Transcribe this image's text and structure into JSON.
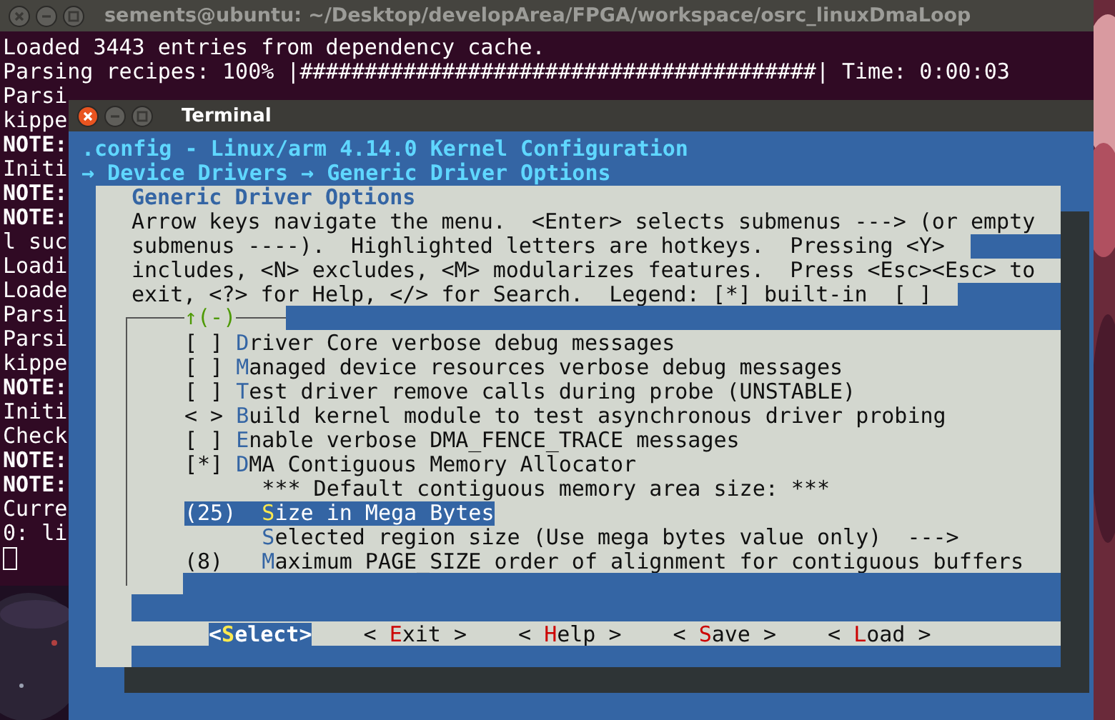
{
  "back_terminal": {
    "title": "sements@ubuntu: ~/Desktop/developArea/FPGA/workspace/osrc_linuxDmaLoop",
    "lines": [
      {
        "text": "Loaded 3443 entries from dependency cache.",
        "bold": false
      },
      {
        "text": "Parsing recipes: 100% |########################################| Time: 0:00:03",
        "bold": false
      },
      {
        "text": "Parsi",
        "bold": false
      },
      {
        "text": "kippe",
        "bold": false
      },
      {
        "text": "NOTE:",
        "bold": true
      },
      {
        "text": "Initi",
        "bold": false
      },
      {
        "text": "NOTE:",
        "bold": true
      },
      {
        "text": "NOTE:",
        "bold": true
      },
      {
        "text": "l suc",
        "bold": false
      },
      {
        "text": "Loadi",
        "bold": false
      },
      {
        "text": "Loade",
        "bold": false
      },
      {
        "text": "Parsi",
        "bold": false
      },
      {
        "text": "Parsi",
        "bold": false
      },
      {
        "text": "kippe",
        "bold": false
      },
      {
        "text": "NOTE:",
        "bold": true
      },
      {
        "text": "Initi",
        "bold": false
      },
      {
        "text": "Check",
        "bold": false
      },
      {
        "text": "NOTE:",
        "bold": true
      },
      {
        "text": "NOTE:",
        "bold": true
      },
      {
        "text": "Curre",
        "bold": false
      },
      {
        "text": "0: li",
        "bold": false
      }
    ]
  },
  "terminal": {
    "title": "Terminal",
    "header": ".config - Linux/arm 4.14.0 Kernel Configuration",
    "breadcrumb": "→ Device Drivers → Generic Driver Options",
    "dialog": {
      "title": "Generic Driver Options",
      "help_lines": [
        "Arrow keys navigate the menu.  <Enter> selects submenus ---> (or empty",
        "submenus ----).  Highlighted letters are hotkeys.  Pressing <Y>",
        "includes, <N> excludes, <M> modularizes features.  Press <Esc><Esc> to",
        "exit, <?> for Help, </> for Search.  Legend: [*] built-in  [ ]"
      ],
      "scroll_indicator": "↑(-)",
      "items": [
        {
          "value": "[ ]",
          "key": "D",
          "rest": "river Core verbose debug messages",
          "indented": false,
          "selected": false
        },
        {
          "value": "[ ]",
          "key": "M",
          "rest": "anaged device resources verbose debug messages",
          "indented": false,
          "selected": false
        },
        {
          "value": "[ ]",
          "key": "T",
          "rest": "est driver remove calls during probe (UNSTABLE)",
          "indented": false,
          "selected": false
        },
        {
          "value": "< >",
          "key": "B",
          "rest": "uild kernel module to test asynchronous driver probing",
          "indented": false,
          "selected": false
        },
        {
          "value": "[ ]",
          "key": "E",
          "rest": "nable verbose DMA_FENCE_TRACE messages",
          "indented": false,
          "selected": false
        },
        {
          "value": "[*]",
          "key": "D",
          "rest": "MA Contiguous Memory Allocator",
          "indented": false,
          "selected": false
        },
        {
          "rest": "*** Default contiguous memory area size: ***",
          "indented": true,
          "selected": false
        },
        {
          "value": "(25)",
          "key": "S",
          "rest": "ize in Mega Bytes",
          "indented": true,
          "selected": true
        },
        {
          "key": "S",
          "rest": "elected region size (Use mega bytes value only)  --->",
          "indented": true,
          "selected": false
        },
        {
          "value": "(8)",
          "key": "M",
          "rest": "aximum PAGE_SIZE order of alignment for contiguous buffers",
          "indented": true,
          "selected": false
        }
      ],
      "buttons": [
        {
          "open": "<",
          "key": "S",
          "rest": "elect",
          "close": ">",
          "selected": true
        },
        {
          "open": "< ",
          "key": "E",
          "rest": "xit",
          "close": " >",
          "selected": false
        },
        {
          "open": "< ",
          "key": "H",
          "rest": "elp",
          "close": " >",
          "selected": false
        },
        {
          "open": "< ",
          "key": "S",
          "rest": "ave",
          "close": " >",
          "selected": false
        },
        {
          "open": "< ",
          "key": "L",
          "rest": "oad",
          "close": " >",
          "selected": false
        }
      ]
    }
  }
}
